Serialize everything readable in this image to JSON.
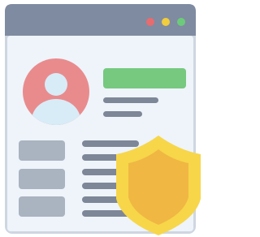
{
  "icon": "profile-window-shield-icon",
  "colors": {
    "window_frame": "#cfd6e0",
    "title_bar": "#7f8ba0",
    "window_body": "#eef4fa",
    "dot_red": "#e86b6f",
    "dot_yellow": "#f2cd3c",
    "dot_green": "#6ccb7a",
    "avatar_bg": "#e98b8d",
    "avatar_person": "#d7ecf7",
    "name_bar": "#76c97f",
    "text_lines": "#7d8797",
    "field_boxes": "#aab3c0",
    "shield_outer": "#f7d64a",
    "shield_inner": "#f0b743"
  }
}
